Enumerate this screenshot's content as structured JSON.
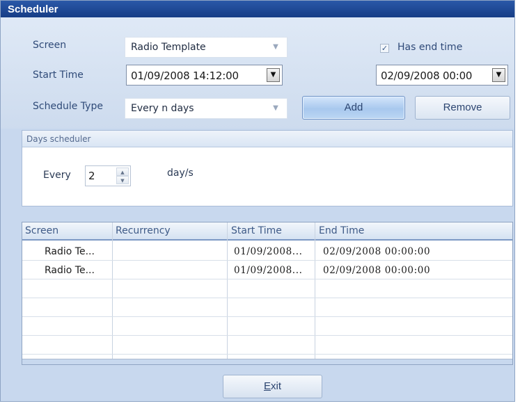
{
  "window": {
    "title": "Scheduler"
  },
  "form": {
    "screen_label": "Screen",
    "screen_value": "Radio Template",
    "start_time_label": "Start Time",
    "start_time_value": "01/09/2008 14:12:00",
    "schedule_type_label": "Schedule Type",
    "schedule_type_value": "Every n days",
    "has_end_time_label": "Has end time",
    "has_end_time_checked": true,
    "end_time_value": "02/09/2008  00:00"
  },
  "buttons": {
    "add": "Add",
    "remove": "Remove",
    "exit_prefix": "E",
    "exit_rest": "xit"
  },
  "days_scheduler": {
    "title": "Days scheduler",
    "every_label": "Every",
    "every_value": "2",
    "unit_label": "day/s"
  },
  "grid": {
    "columns": [
      "Screen",
      "Recurrency",
      "Start Time",
      "End Time"
    ],
    "rows": [
      {
        "screen": "Radio Te...",
        "recurrency": "",
        "start": "01/09/2008...",
        "end": "02/09/2008 00:00:00"
      },
      {
        "screen": "Radio Te...",
        "recurrency": "",
        "start": "01/09/2008...",
        "end": "02/09/2008 00:00:00"
      }
    ]
  },
  "icons": {
    "dropdown": "chevron-down-icon",
    "check": "checkmark-icon",
    "spin_up": "spin-up-icon",
    "spin_down": "spin-down-icon"
  },
  "colors": {
    "title_bar": "#1f4c9c",
    "background": "#c8d8ee",
    "accent_button": "#a8c8ee"
  }
}
